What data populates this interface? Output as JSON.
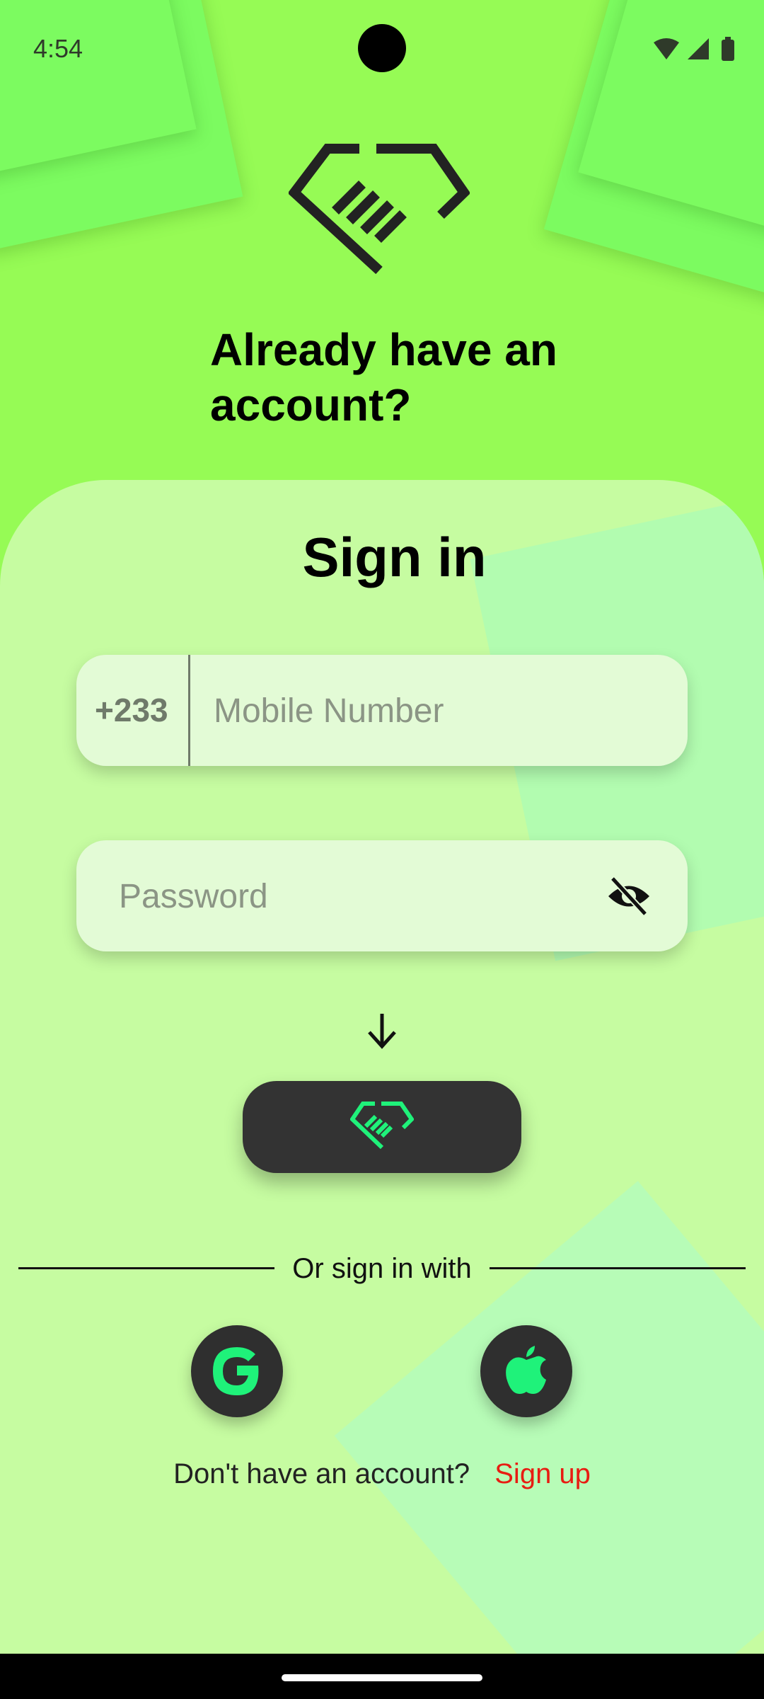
{
  "status_bar": {
    "time": "4:54"
  },
  "header": {
    "headline": "Already have an account?"
  },
  "signin": {
    "title": "Sign in",
    "country_code": "+233",
    "phone_placeholder": "Mobile Number",
    "password_placeholder": "Password"
  },
  "social": {
    "divider_text": "Or sign in with"
  },
  "footer": {
    "prompt": "Don't have an account?",
    "signup_link": "Sign up"
  },
  "colors": {
    "background": "#96fb55",
    "card": "#c6fca1",
    "button": "#333333",
    "accent_green": "#1ff27a",
    "link_red": "#e81c12"
  },
  "icons": [
    "handshake-logo-icon",
    "eye-off-icon",
    "arrow-down-icon",
    "google-icon",
    "apple-icon",
    "wifi-icon",
    "signal-icon",
    "battery-icon"
  ]
}
